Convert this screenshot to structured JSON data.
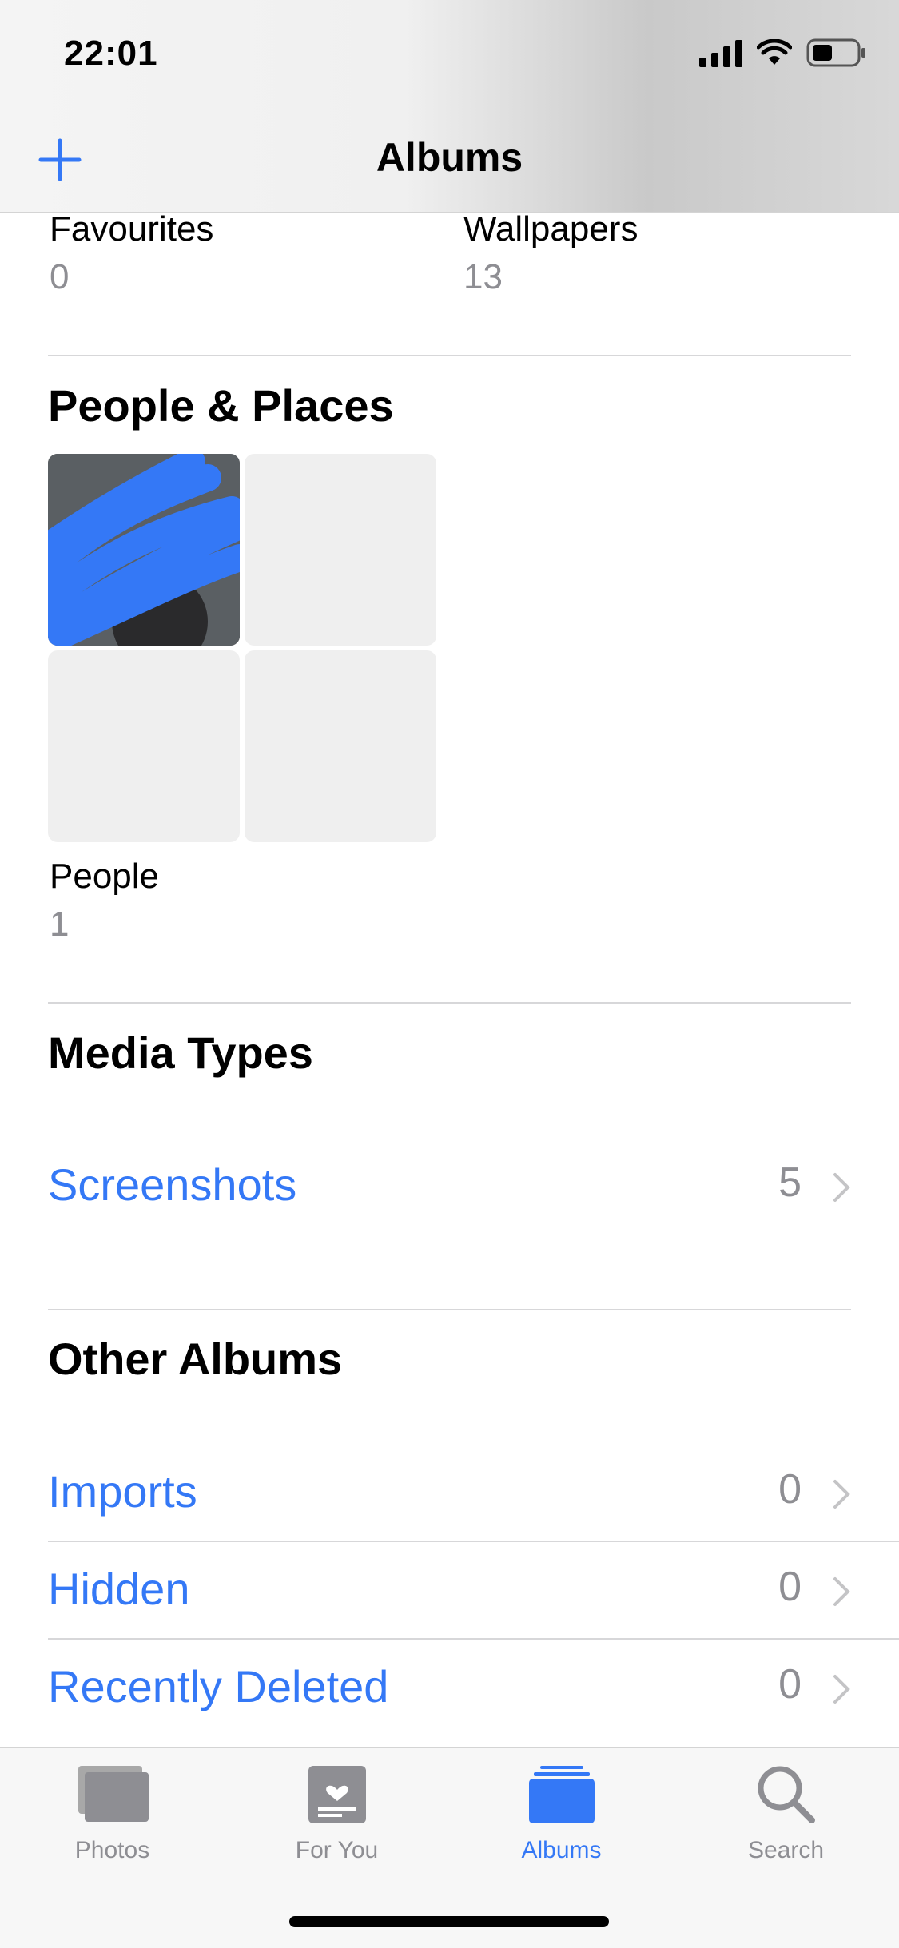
{
  "status_bar": {
    "time": "22:01"
  },
  "nav": {
    "title": "Albums",
    "add_icon": "plus-icon"
  },
  "top_albums": [
    {
      "name": "Favourites",
      "count": "0"
    },
    {
      "name": "Wallpapers",
      "count": "13"
    }
  ],
  "people_places": {
    "title": "People & Places",
    "album": {
      "name": "People",
      "count": "1"
    }
  },
  "media_types": {
    "title": "Media Types",
    "rows": [
      {
        "label": "Screenshots",
        "count": "5"
      }
    ]
  },
  "other_albums": {
    "title": "Other Albums",
    "rows": [
      {
        "label": "Imports",
        "count": "0"
      },
      {
        "label": "Hidden",
        "count": "0"
      },
      {
        "label": "Recently Deleted",
        "count": "0"
      }
    ]
  },
  "tabbar": {
    "tabs": [
      {
        "label": "Photos",
        "icon": "photos-icon"
      },
      {
        "label": "For You",
        "icon": "for-you-icon"
      },
      {
        "label": "Albums",
        "icon": "albums-icon",
        "active": true
      },
      {
        "label": "Search",
        "icon": "search-icon"
      }
    ]
  },
  "colors": {
    "accent": "#3478f6",
    "secondary_text": "#8e8e93",
    "tile": "#efefef"
  }
}
